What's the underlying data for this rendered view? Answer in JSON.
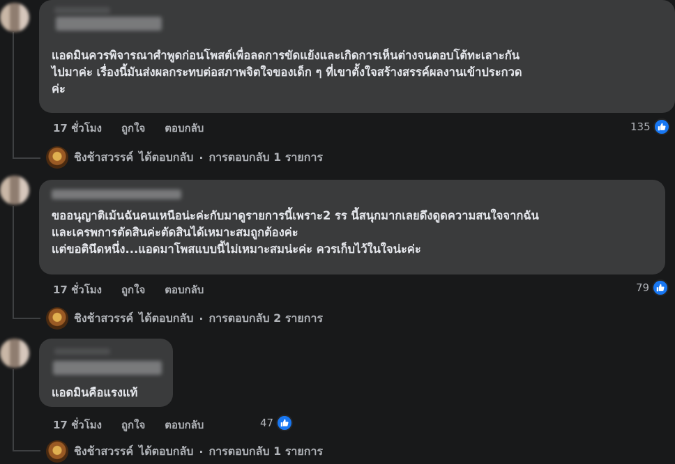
{
  "comments": [
    {
      "lines": [
        "แอดมินควรพิจารณาศำพูดก่อนโพสต์เพื่อลดการขัดแย้งและเกิดการเห็นต่างจนตอบโต้ทะเลาะกัน",
        "ไปมาค่ะ เรื่องนี้มันส่งผลกระทบต่อสภาพจิตใจของเด็ก ๆ ที่เขาตั้งใจสร้างสรรค์ผลงานเข้าประกวด",
        "ค่ะ"
      ],
      "time": "17 ชั่วโมง",
      "like_label": "ถูกใจ",
      "reply_label": "ตอบกลับ",
      "likes": "135",
      "reply_summary": {
        "name": "ชิงช้าสวรรค์",
        "action": "ได้ตอบกลับ",
        "separator": "·",
        "count_text": "การตอบกลับ 1 รายการ"
      }
    },
    {
      "lines": [
        "ขออนุญาติเม้นฉันคนเหนือน่ะค่ะกับมาดูรายการนี้เพราะ2 รร นี้สนุกมากเลยดึงดูดความสนใจจากฉัน",
        "และเครพการตัดสินค่ะตัดสินได้เหมาะสมถูกต้องค่ะ",
        "แต่ขอตินึดหนึ่ง...แอดมาโพสแบบนี้ไม่เหมาะสมน่ะค่ะ ควรเก็บไว้ในใจน่ะค่ะ"
      ],
      "time": "17 ชั่วโมง",
      "like_label": "ถูกใจ",
      "reply_label": "ตอบกลับ",
      "likes": "79",
      "reply_summary": {
        "name": "ชิงช้าสวรรค์",
        "action": "ได้ตอบกลับ",
        "separator": "·",
        "count_text": "การตอบกลับ 2 รายการ"
      }
    },
    {
      "lines": [
        "แอดมินคือแรงแท้"
      ],
      "time": "17 ชั่วโมง",
      "like_label": "ถูกใจ",
      "reply_label": "ตอบกลับ",
      "likes": "47",
      "reply_summary": {
        "name": "ชิงช้าสวรรค์",
        "action": "ได้ตอบกลับ",
        "separator": "·",
        "count_text": "การตอบกลับ 1 รายการ"
      }
    }
  ],
  "colors": {
    "background": "#18191a",
    "bubble": "#3a3b3c",
    "text": "#e4e6eb",
    "meta": "#b0b3b8",
    "like_blue": "#1877f2"
  },
  "icons": {
    "like": "thumbs-up-icon"
  }
}
